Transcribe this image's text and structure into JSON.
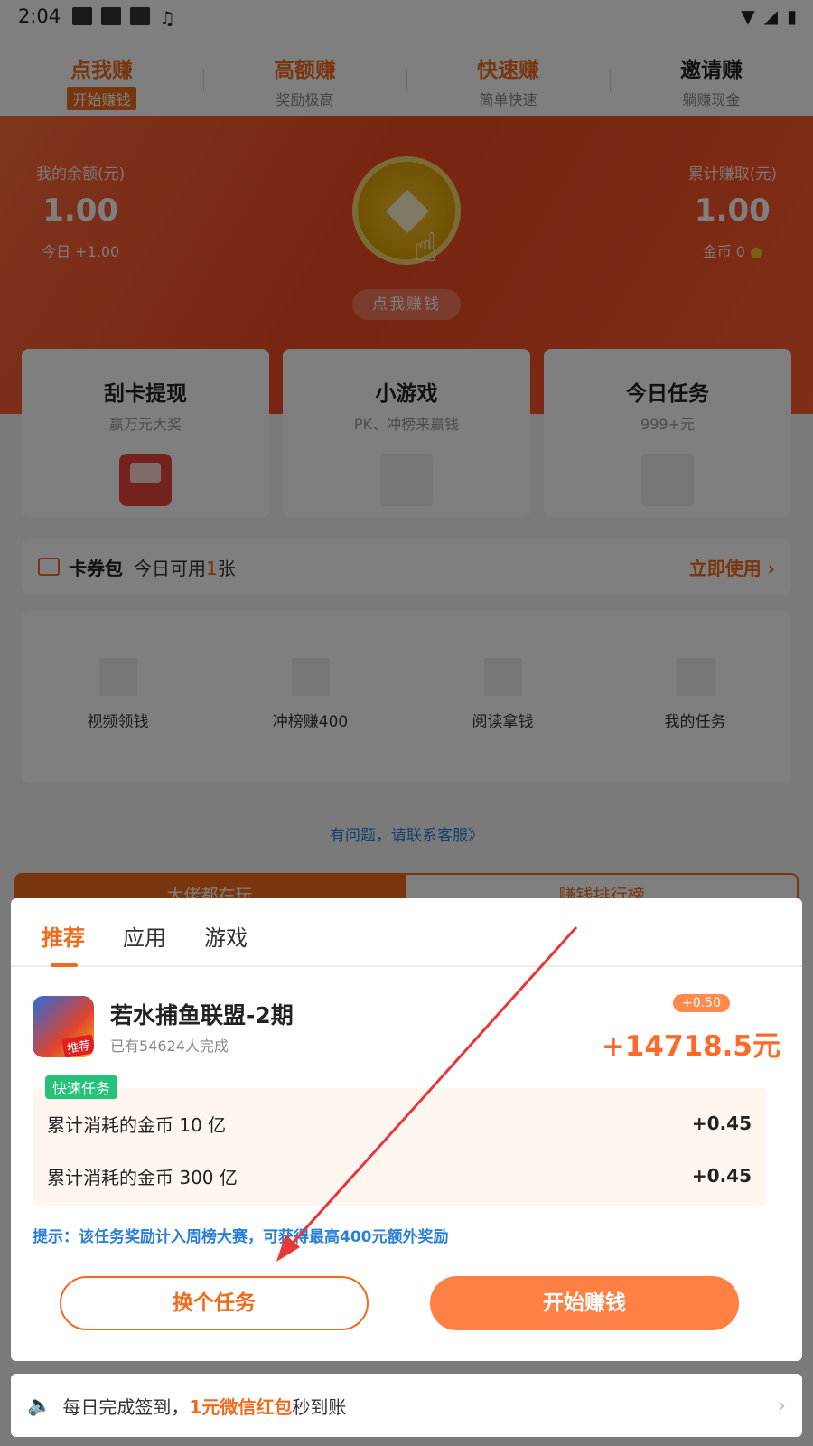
{
  "status": {
    "time": "2:04"
  },
  "top_tabs": [
    {
      "title": "点我赚",
      "sub": "开始赚钱"
    },
    {
      "title": "高额赚",
      "sub": "奖励极高"
    },
    {
      "title": "快速赚",
      "sub": "简单快速"
    },
    {
      "title": "邀请赚",
      "sub": "躺赚现金"
    }
  ],
  "banner": {
    "balance_label": "我的余额(元)",
    "balance_value": "1.00",
    "today": "今日 +1.00",
    "total_label": "累计赚取(元)",
    "total_value": "1.00",
    "coins": "金币 0",
    "coin_button": "点我赚钱"
  },
  "cards": [
    {
      "title": "刮卡提现",
      "sub": "赢万元大奖"
    },
    {
      "title": "小游戏",
      "sub": "PK、冲榜来赢钱"
    },
    {
      "title": "今日任务",
      "sub": "999+元"
    }
  ],
  "coupon": {
    "title": "卡券包",
    "desc_pre": "今日可用",
    "count": "1",
    "desc_post": "张",
    "use": "立即使用"
  },
  "grid": [
    {
      "label": "视频领钱"
    },
    {
      "label": "冲榜赚400"
    },
    {
      "label": "阅读拿钱"
    },
    {
      "label": "我的任务"
    }
  ],
  "help": "有问题，请联系客服》",
  "bottom_tabs": {
    "left": "大佬都在玩",
    "right": "赚钱排行榜"
  },
  "modal": {
    "tabs": [
      "推荐",
      "应用",
      "游戏"
    ],
    "app": {
      "icon_tag": "推荐",
      "name": "若水捕鱼联盟-2期",
      "count": "已有54624人完成",
      "bonus": "+0.50",
      "reward": "+14718.5元"
    },
    "task_tag": "快速任务",
    "tasks": [
      {
        "desc": "累计消耗的金币 10 亿",
        "value": "+0.45"
      },
      {
        "desc": "累计消耗的金币 300 亿",
        "value": "+0.45"
      }
    ],
    "tip": "提示：该任务奖励计入周榜大赛，可获得最高400元额外奖励",
    "swap_button": "换个任务",
    "start_button": "开始赚钱"
  },
  "notice": {
    "pre": "每日完成签到，",
    "highlight": "1元微信红包",
    "post": "秒到账"
  },
  "colors": {
    "accent": "#f26b1d",
    "banner": "#f04a22",
    "link": "#2a7fd6",
    "tag_green": "#27c27a",
    "annotation_arrow": "#e8363a"
  }
}
